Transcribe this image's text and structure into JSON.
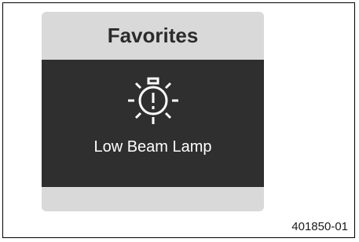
{
  "panel": {
    "title": "Favorites",
    "item": {
      "label": "Low Beam Lamp",
      "icon": "low-beam-lamp-warning-icon"
    }
  },
  "reference_code": "401850-01",
  "colors": {
    "panel_bg": "#d9d9d9",
    "band_bg": "#2f2f2f",
    "icon_color": "#ffffff",
    "title_color": "#2b2b2b"
  }
}
